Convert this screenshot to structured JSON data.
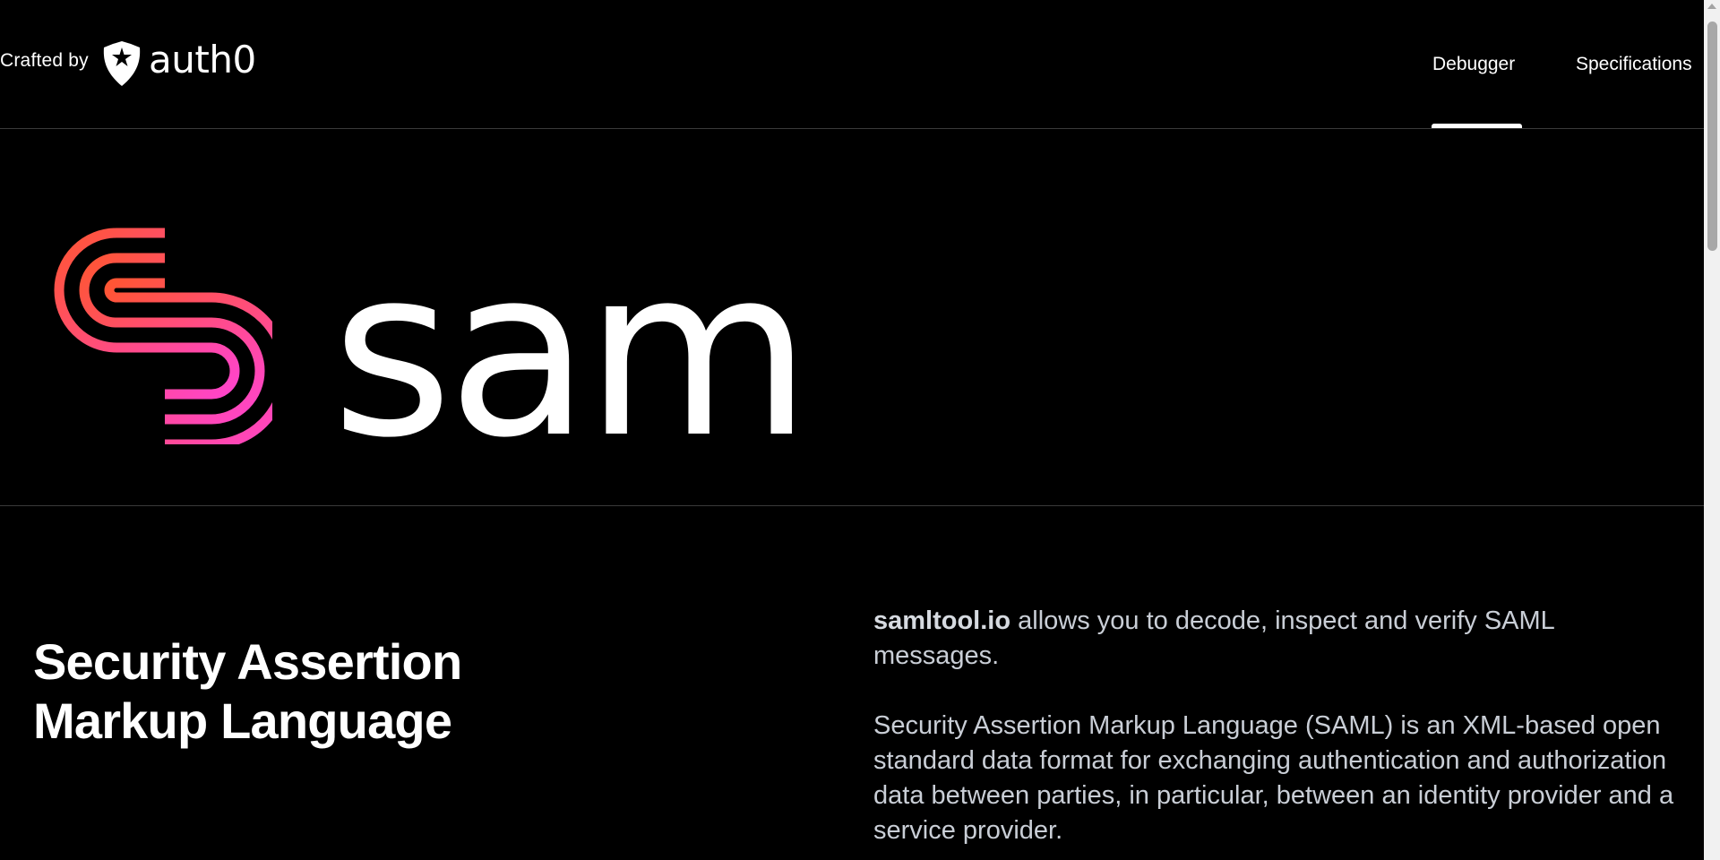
{
  "header": {
    "crafted_by": "Crafted by",
    "brand_name": "auth0",
    "brand_icon": "auth0-shield-icon",
    "nav": [
      {
        "label": "Debugger",
        "active": true
      },
      {
        "label": "Specifications",
        "active": false
      }
    ]
  },
  "hero": {
    "logo_icon": "saml-s-icon",
    "wordmark": "saml",
    "gradient": [
      "#ff5533",
      "#ff44cc"
    ]
  },
  "content": {
    "title": "Security Assertion Markup Language",
    "intro_brand": "samltool.io",
    "intro_rest": " allows you to decode, inspect and verify SAML messages.",
    "description": "Security Assertion Markup Language (SAML) is an XML-based open standard data format for exchanging authentication and authorization data between parties, in particular, between an identity provider and a service provider."
  },
  "colors": {
    "background": "#000000",
    "text": "#ffffff",
    "body_text": "#c9ced6"
  }
}
